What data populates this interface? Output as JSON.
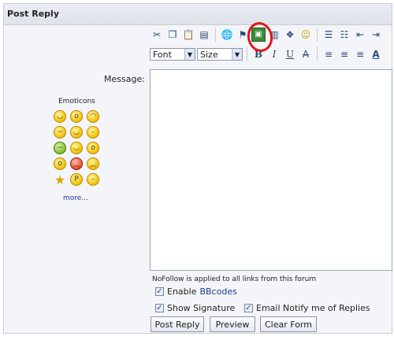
{
  "panel": {
    "title": "Post Reply"
  },
  "toolbar_top": {
    "icons": [
      "cut-icon",
      "copy-icon",
      "paste-icon",
      "paste-word-icon",
      "link-icon",
      "unlink-icon",
      "image-icon",
      "table-icon",
      "media-icon",
      "emoticon-icon",
      "ordered-list-icon",
      "unordered-list-icon",
      "outdent-icon",
      "indent-icon"
    ]
  },
  "toolbar_format": {
    "font_select": "Font",
    "size_select": "Size",
    "icons": [
      "bold-icon",
      "italic-icon",
      "underline-icon",
      "strikethrough-icon",
      "align-left-icon",
      "align-center-icon",
      "align-right-icon",
      "text-color-icon"
    ]
  },
  "message": {
    "label": "Message:"
  },
  "emoticons": {
    "title": "Emoticons",
    "more_link": "more..."
  },
  "options": {
    "nofollow_note": "NoFollow is applied to all links from this forum",
    "enable_prefix": "Enable",
    "bbcodes_link": "BBcodes",
    "show_signature": "Show Signature",
    "email_notify": "Email Notify me of Replies"
  },
  "buttons": {
    "post_reply": "Post Reply",
    "preview": "Preview",
    "clear_form": "Clear Form"
  },
  "annotation": {
    "highlight_color": "#e01818"
  }
}
